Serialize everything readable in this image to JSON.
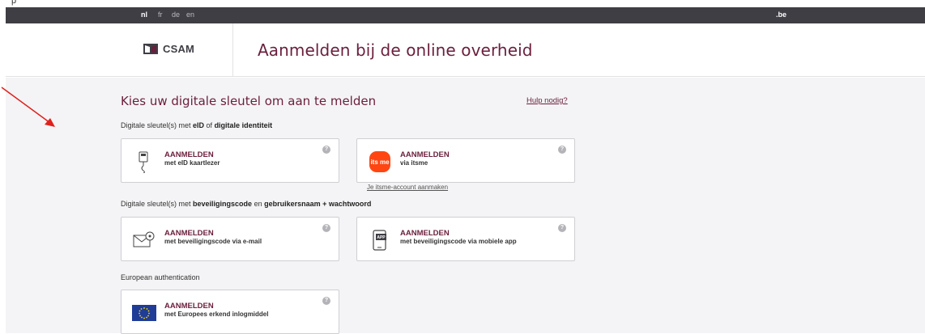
{
  "top_strip": {
    "text": "p"
  },
  "lang_bar": {
    "languages": [
      {
        "code": "nl",
        "active": true
      },
      {
        "code": "fr",
        "active": false
      },
      {
        "code": "de",
        "active": false
      },
      {
        "code": "en",
        "active": false
      }
    ],
    "domain": ".be"
  },
  "header": {
    "logo_text": "CSAM",
    "title": "Aanmelden bij de online overheid"
  },
  "main": {
    "heading": "Kies uw digitale sleutel om aan te melden",
    "help_link": "Hulp nodig?",
    "sections": [
      {
        "label_parts": [
          "Digitale sleutel(s) met ",
          "eID",
          " of ",
          "digitale identiteit"
        ],
        "cards": [
          {
            "title": "AANMELDEN",
            "subtitle": "met eID kaartlezer",
            "icon": "card-reader-icon"
          },
          {
            "title": "AANMELDEN",
            "subtitle": "via itsme",
            "icon": "itsme-logo",
            "logo_text": "its me",
            "link": "Je itsme-account aanmaken"
          }
        ]
      },
      {
        "label_parts": [
          "Digitale sleutel(s) met ",
          "beveiligingscode",
          " en ",
          "gebruikersnaam + wachtwoord"
        ],
        "cards": [
          {
            "title": "AANMELDEN",
            "subtitle": "met beveiligingscode via e-mail",
            "icon": "email-lock-icon"
          },
          {
            "title": "AANMELDEN",
            "subtitle": "met beveiligingscode via mobiele app",
            "icon": "mobile-app-icon",
            "logo_text": "APP"
          }
        ]
      },
      {
        "label": "European authentication",
        "cards": [
          {
            "title": "AANMELDEN",
            "subtitle": "met Europees erkend inlogmiddel",
            "icon": "eu-flag-icon"
          }
        ]
      }
    ]
  },
  "colors": {
    "brand": "#6a1f3c",
    "lang_bar": "#3f3e45",
    "background": "#f4f4f6",
    "itsme": "#ff4612",
    "eu_blue": "#1f3c96",
    "annotation_arrow": "#e0201e"
  },
  "help_icon_glyph": "?"
}
